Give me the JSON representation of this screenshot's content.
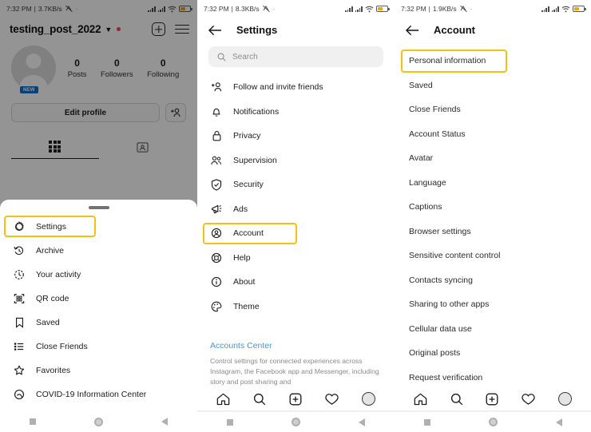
{
  "panels": [
    {
      "id": "profile",
      "statusbar": {
        "time": "7:32 PM",
        "separator": "|",
        "speed": "3.7KB/s",
        "dot": "·"
      },
      "header": {
        "username": "testing_post_2022",
        "caret": "chevron-down-icon",
        "add_icon": "plus-square-icon",
        "menu_icon": "hamburger-menu-icon"
      },
      "profile": {
        "avatar_badge": "NEW",
        "stats": [
          {
            "value": "0",
            "label": "Posts"
          },
          {
            "value": "0",
            "label": "Followers"
          },
          {
            "value": "0",
            "label": "Following"
          }
        ],
        "edit_label": "Edit profile",
        "add_people_icon": "add-person-icon",
        "tabs": [
          {
            "icon": "grid-icon",
            "active": true
          },
          {
            "icon": "tagged-icon",
            "active": false
          }
        ]
      },
      "sheet": {
        "items": [
          {
            "label": "Settings",
            "icon": "gear-icon",
            "highlighted": true
          },
          {
            "label": "Archive",
            "icon": "archive-clock-icon",
            "highlighted": false
          },
          {
            "label": "Your activity",
            "icon": "activity-clock-icon",
            "highlighted": false
          },
          {
            "label": "QR code",
            "icon": "qr-code-icon",
            "highlighted": false
          },
          {
            "label": "Saved",
            "icon": "bookmark-icon",
            "highlighted": false
          },
          {
            "label": "Close Friends",
            "icon": "list-icon",
            "highlighted": false
          },
          {
            "label": "Favorites",
            "icon": "star-icon",
            "highlighted": false
          },
          {
            "label": "COVID-19 Information Center",
            "icon": "covid-info-icon",
            "highlighted": false
          }
        ]
      }
    },
    {
      "id": "settings",
      "statusbar": {
        "time": "7:32 PM",
        "separator": "|",
        "speed": "8.3KB/s",
        "dot": "·"
      },
      "header": {
        "title": "Settings",
        "back_icon": "back-arrow-icon"
      },
      "search": {
        "placeholder": "Search",
        "icon": "search-icon"
      },
      "items": [
        {
          "label": "Follow and invite friends",
          "icon": "add-person-icon",
          "highlighted": false
        },
        {
          "label": "Notifications",
          "icon": "bell-icon",
          "highlighted": false
        },
        {
          "label": "Privacy",
          "icon": "lock-icon",
          "highlighted": false
        },
        {
          "label": "Supervision",
          "icon": "people-icon",
          "highlighted": false
        },
        {
          "label": "Security",
          "icon": "shield-check-icon",
          "highlighted": false
        },
        {
          "label": "Ads",
          "icon": "megaphone-icon",
          "highlighted": false
        },
        {
          "label": "Account",
          "icon": "account-circle-icon",
          "highlighted": true
        },
        {
          "label": "Help",
          "icon": "help-lifebuoy-icon",
          "highlighted": false
        },
        {
          "label": "About",
          "icon": "info-icon",
          "highlighted": false
        },
        {
          "label": "Theme",
          "icon": "palette-icon",
          "highlighted": false
        }
      ],
      "accounts_center": {
        "link": "Accounts Center",
        "description": "Control settings for connected experiences across Instagram, the Facebook app and Messenger, including story and post sharing and"
      }
    },
    {
      "id": "account",
      "statusbar": {
        "time": "7:32 PM",
        "separator": "|",
        "speed": "1.9KB/s",
        "dot": "·"
      },
      "header": {
        "title": "Account",
        "back_icon": "back-arrow-icon"
      },
      "items": [
        {
          "label": "Personal information",
          "highlighted": true
        },
        {
          "label": "Saved",
          "highlighted": false
        },
        {
          "label": "Close Friends",
          "highlighted": false
        },
        {
          "label": "Account Status",
          "highlighted": false
        },
        {
          "label": "Avatar",
          "highlighted": false
        },
        {
          "label": "Language",
          "highlighted": false
        },
        {
          "label": "Captions",
          "highlighted": false
        },
        {
          "label": "Browser settings",
          "highlighted": false
        },
        {
          "label": "Sensitive content control",
          "highlighted": false
        },
        {
          "label": "Contacts syncing",
          "highlighted": false
        },
        {
          "label": "Sharing to other apps",
          "highlighted": false
        },
        {
          "label": "Cellular data use",
          "highlighted": false
        },
        {
          "label": "Original posts",
          "highlighted": false
        },
        {
          "label": "Request verification",
          "highlighted": false
        }
      ]
    }
  ],
  "app_nav": [
    {
      "icon": "home-icon",
      "label": "Home"
    },
    {
      "icon": "search-icon",
      "label": "Search"
    },
    {
      "icon": "plus-square-icon",
      "label": "Create"
    },
    {
      "icon": "heart-icon",
      "label": "Activity"
    },
    {
      "icon": "profile-avatar-icon",
      "label": "Profile"
    }
  ],
  "system_nav": [
    {
      "icon": "recents-square-icon",
      "label": "Recents"
    },
    {
      "icon": "home-circle-icon",
      "label": "Home"
    },
    {
      "icon": "back-triangle-icon",
      "label": "Back"
    }
  ],
  "colors": {
    "highlight": "#f3c013",
    "link": "#3b9ae1",
    "badge": "#0f6fd1",
    "notification_dot": "#ed4956",
    "battery": "#f0a500"
  }
}
